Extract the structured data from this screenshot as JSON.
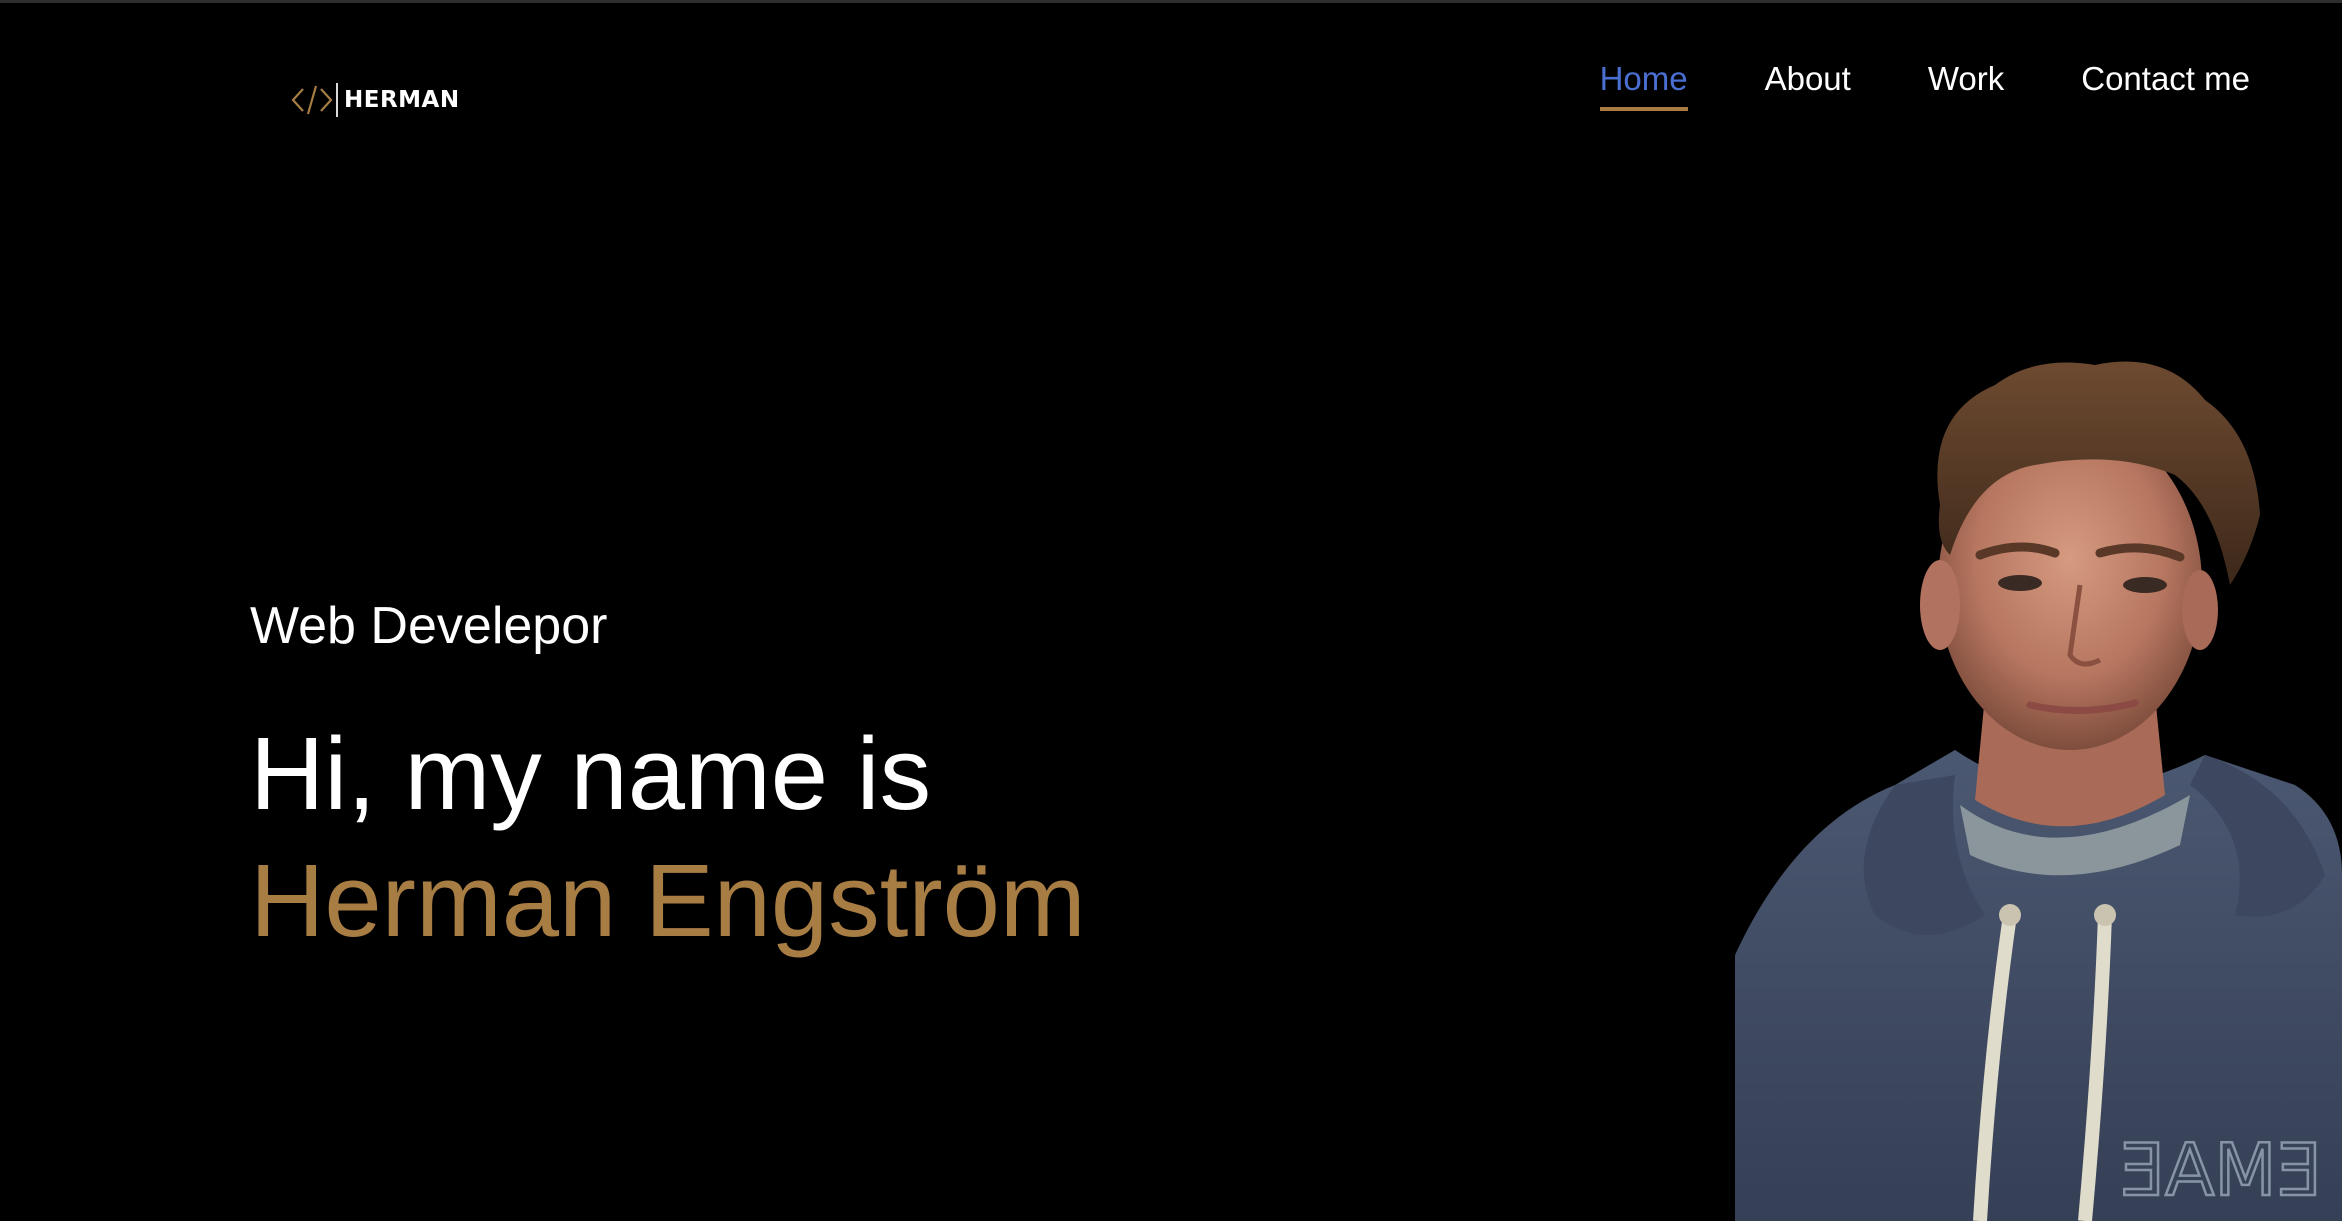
{
  "header": {
    "logo": {
      "text": "HERMAN",
      "icon": "code-brackets-icon"
    },
    "nav": [
      {
        "label": "Home",
        "active": true
      },
      {
        "label": "About",
        "active": false
      },
      {
        "label": "Work",
        "active": false
      },
      {
        "label": "Contact me",
        "active": false
      }
    ]
  },
  "hero": {
    "role": "Web Develepor",
    "greeting": "Hi, my name is",
    "name": "Herman Engström"
  },
  "portrait": {
    "hoodie_print": "EMAE"
  },
  "colors": {
    "background": "#000000",
    "accent_gold": "#a77d44",
    "active_link": "#4a6fd1",
    "text": "#ffffff"
  }
}
